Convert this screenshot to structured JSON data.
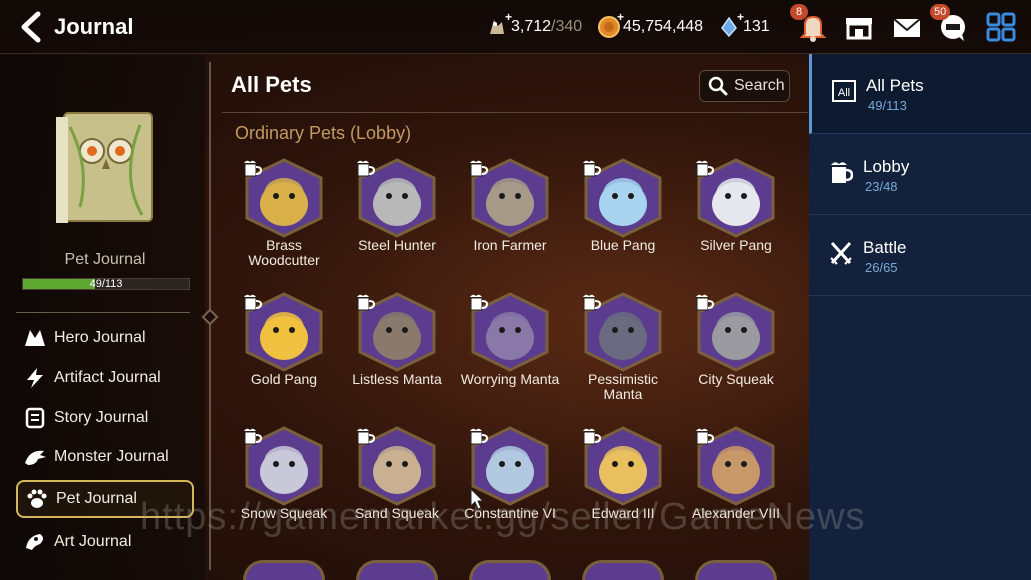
{
  "header": {
    "title": "Journal",
    "stamina": {
      "value": "3,712",
      "max": "/340"
    },
    "gold": {
      "value": "45,754,448"
    },
    "skystone": {
      "value": "131"
    },
    "notifications_badge": "8",
    "mail_badge": "50"
  },
  "journal": {
    "label": "Pet Journal",
    "progress_text": "49/113",
    "progress_fraction": 0.434
  },
  "menu": [
    {
      "label": "Hero Journal",
      "icon": "hero-icon"
    },
    {
      "label": "Artifact Journal",
      "icon": "artifact-icon"
    },
    {
      "label": "Story Journal",
      "icon": "story-icon"
    },
    {
      "label": "Monster Journal",
      "icon": "monster-icon"
    },
    {
      "label": "Pet Journal",
      "icon": "paw-icon",
      "active": true
    },
    {
      "label": "Art Journal",
      "icon": "art-icon"
    }
  ],
  "main": {
    "title": "All Pets",
    "search_label": "Search",
    "section_title": "Ordinary Pets (Lobby)",
    "pets": [
      {
        "name": "Brass Woodcutter",
        "color": "#d9b04a"
      },
      {
        "name": "Steel Hunter",
        "color": "#b8b8b8"
      },
      {
        "name": "Iron Farmer",
        "color": "#a89a88"
      },
      {
        "name": "Blue Pang",
        "color": "#a8d4f0"
      },
      {
        "name": "Silver Pang",
        "color": "#e6e6ee"
      },
      {
        "name": "Gold Pang",
        "color": "#f0c040"
      },
      {
        "name": "Listless Manta",
        "color": "#8a7a6e"
      },
      {
        "name": "Worrying Manta",
        "color": "#8a78a8"
      },
      {
        "name": "Pessimistic Manta",
        "color": "#6a6a80"
      },
      {
        "name": "City Squeak",
        "color": "#9a9aa0"
      },
      {
        "name": "Snow Squeak",
        "color": "#c8c8d8"
      },
      {
        "name": "Sand Squeak",
        "color": "#c8b090"
      },
      {
        "name": "Constantine VI",
        "color": "#b0c8e0"
      },
      {
        "name": "Edward III",
        "color": "#e8c060"
      },
      {
        "name": "Alexander VIII",
        "color": "#c89868"
      }
    ]
  },
  "categories": [
    {
      "label": "All Pets",
      "count": "49/113",
      "icon": "all-icon",
      "active": true
    },
    {
      "label": "Lobby",
      "count": "23/48",
      "icon": "lobby-icon"
    },
    {
      "label": "Battle",
      "count": "26/65",
      "icon": "battle-icon"
    }
  ],
  "watermark": "https://gamemarket.gg/seller/GameNews",
  "colors": {
    "hex_purple": "#5b3c8e",
    "hex_border": "#7a5f3a",
    "panel_blue": "#13213c",
    "section_gold": "#c29a60"
  }
}
